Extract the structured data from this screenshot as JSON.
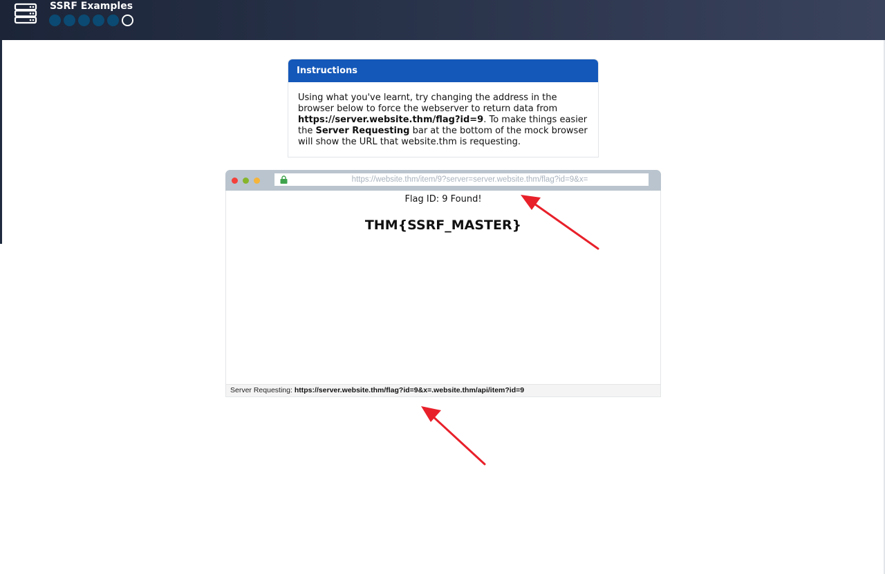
{
  "header": {
    "title": "SSRF Examples",
    "icon": "server-rack-icon",
    "progress": {
      "total_steps": 6,
      "current_step": 6
    }
  },
  "instructions": {
    "heading": "Instructions",
    "text_1": "Using what you've learnt, try changing the address in the browser below to force the webserver to return data from ",
    "target_url": "https://server.website.thm/flag?id=9",
    "text_2": ". To make things easier the ",
    "highlight": "Server Requesting",
    "text_3": " bar at the bottom of the mock browser will show the URL that website.thm is requesting."
  },
  "mock_browser": {
    "address": "https://website.thm/item/9?server=server.website.thm/flag?id=9&x=",
    "lock_icon": "lock-icon",
    "content_line": "Flag ID: 9 Found!",
    "flag": "THM{SSRF_MASTER}",
    "server_requesting_label": "Server Requesting:",
    "server_requesting_url": "https://server.website.thm/flag?id=9&x=.website.thm/api/item?id=9"
  },
  "annotations": {
    "arrow_color": "#e8202a"
  },
  "colors": {
    "header_bg": "#283249",
    "instructions_header": "#1458b9",
    "step_done": "#0b4a72",
    "toolbar": "#b9c4ce"
  }
}
